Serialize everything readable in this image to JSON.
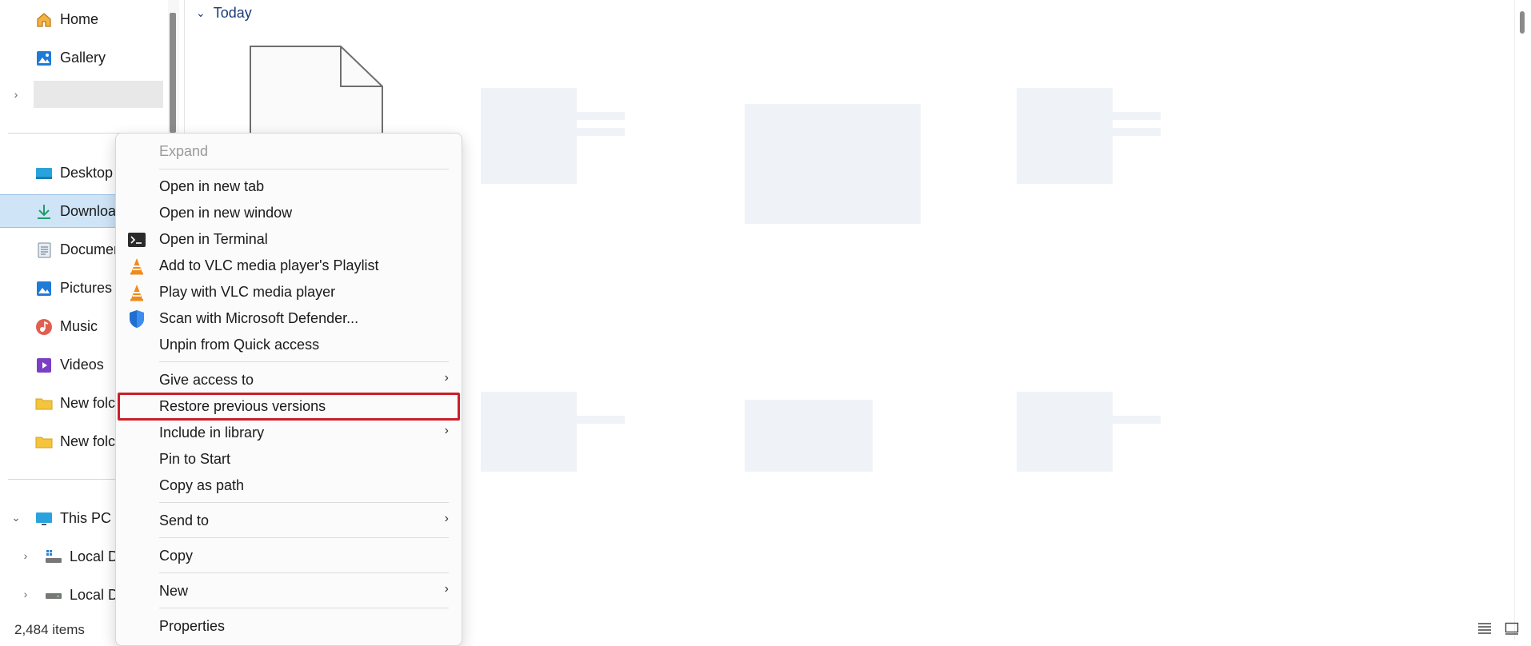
{
  "nav": {
    "quick": [
      {
        "label": "Home",
        "icon": "home-icon"
      },
      {
        "label": "Gallery",
        "icon": "gallery-icon"
      }
    ],
    "pinned": [
      {
        "label": "Desktop",
        "icon": "desktop-icon"
      },
      {
        "label": "Downloa",
        "icon": "download-icon",
        "selected": true
      },
      {
        "label": "Documer",
        "icon": "document-icon"
      },
      {
        "label": "Pictures",
        "icon": "pictures-icon"
      },
      {
        "label": "Music",
        "icon": "music-icon"
      },
      {
        "label": "Videos",
        "icon": "videos-icon"
      },
      {
        "label": "New folc",
        "icon": "folder-icon"
      },
      {
        "label": "New folc",
        "icon": "folder-icon"
      }
    ],
    "this_pc": {
      "label": "This PC",
      "icon": "monitor-icon"
    },
    "drives": [
      {
        "label": "Local D",
        "icon": "windows-drive-icon"
      },
      {
        "label": "Local D",
        "icon": "drive-icon"
      }
    ]
  },
  "content": {
    "group_header": "Today"
  },
  "status": {
    "item_count": "2,484 items"
  },
  "context_menu": {
    "items": [
      {
        "label": "Expand",
        "disabled": true
      },
      {
        "label": "Open in new tab"
      },
      {
        "label": "Open in new window"
      },
      {
        "label": "Open in Terminal",
        "icon": "terminal-icon"
      },
      {
        "label": "Add to VLC media player's Playlist",
        "icon": "vlc-icon"
      },
      {
        "label": "Play with VLC media player",
        "icon": "vlc-icon"
      },
      {
        "label": "Scan with Microsoft Defender...",
        "icon": "defender-shield-icon"
      },
      {
        "label": "Unpin from Quick access"
      },
      {
        "label": "Give access to",
        "submenu": true
      },
      {
        "label": "Restore previous versions",
        "highlighted": true
      },
      {
        "label": "Include in library",
        "submenu": true
      },
      {
        "label": "Pin to Start"
      },
      {
        "label": "Copy as path"
      },
      {
        "label": "Send to",
        "submenu": true
      },
      {
        "label": "Copy"
      },
      {
        "label": "New",
        "submenu": true
      },
      {
        "label": "Properties"
      }
    ]
  },
  "colors": {
    "selection_bg": "#cfe4f7",
    "highlight_border": "#c8202a",
    "header_text": "#1b3a7a"
  }
}
